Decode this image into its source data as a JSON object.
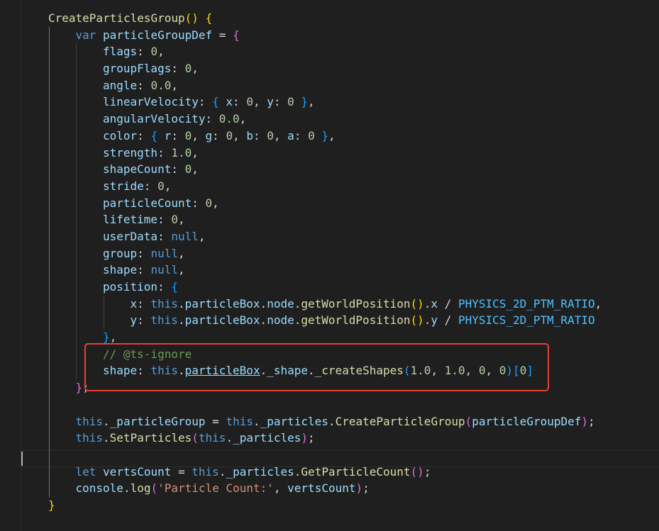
{
  "editor": {
    "theme_colors": {
      "background": "#1f1f1f",
      "function": "#dcdcaa",
      "keyword": "#569cd6",
      "variable": "#9cdcfe",
      "number": "#b5cea8",
      "string": "#ce9178",
      "constant": "#4fc1ff",
      "comment": "#6a9955",
      "bracket_level_1": "#ffd700",
      "bracket_level_2": "#da70d6",
      "bracket_level_3": "#179fff",
      "highlight_box": "#e5412f"
    },
    "lines": [
      {
        "indent": 1,
        "tokens": [
          [
            "fn",
            "CreateParticlesGroup"
          ],
          [
            "b1",
            "()"
          ],
          [
            "p",
            " "
          ],
          [
            "b1",
            "{"
          ]
        ]
      },
      {
        "indent": 2,
        "tokens": [
          [
            "kw",
            "var"
          ],
          [
            "p",
            " "
          ],
          [
            "var",
            "particleGroupDef"
          ],
          [
            "p",
            " = "
          ],
          [
            "b2",
            "{"
          ]
        ]
      },
      {
        "indent": 3,
        "tokens": [
          [
            "var",
            "flags"
          ],
          [
            "p",
            ": "
          ],
          [
            "num",
            "0"
          ],
          [
            "p",
            ","
          ]
        ]
      },
      {
        "indent": 3,
        "tokens": [
          [
            "var",
            "groupFlags"
          ],
          [
            "p",
            ": "
          ],
          [
            "num",
            "0"
          ],
          [
            "p",
            ","
          ]
        ]
      },
      {
        "indent": 3,
        "tokens": [
          [
            "var",
            "angle"
          ],
          [
            "p",
            ": "
          ],
          [
            "num",
            "0.0"
          ],
          [
            "p",
            ","
          ]
        ]
      },
      {
        "indent": 3,
        "tokens": [
          [
            "var",
            "linearVelocity"
          ],
          [
            "p",
            ": "
          ],
          [
            "b3",
            "{"
          ],
          [
            "p",
            " "
          ],
          [
            "var",
            "x"
          ],
          [
            "p",
            ": "
          ],
          [
            "num",
            "0"
          ],
          [
            "p",
            ", "
          ],
          [
            "var",
            "y"
          ],
          [
            "p",
            ": "
          ],
          [
            "num",
            "0"
          ],
          [
            "p",
            " "
          ],
          [
            "b3",
            "}"
          ],
          [
            "p",
            ","
          ]
        ]
      },
      {
        "indent": 3,
        "tokens": [
          [
            "var",
            "angularVelocity"
          ],
          [
            "p",
            ": "
          ],
          [
            "num",
            "0.0"
          ],
          [
            "p",
            ","
          ]
        ]
      },
      {
        "indent": 3,
        "tokens": [
          [
            "var",
            "color"
          ],
          [
            "p",
            ": "
          ],
          [
            "b3",
            "{"
          ],
          [
            "p",
            " "
          ],
          [
            "var",
            "r"
          ],
          [
            "p",
            ": "
          ],
          [
            "num",
            "0"
          ],
          [
            "p",
            ", "
          ],
          [
            "var",
            "g"
          ],
          [
            "p",
            ": "
          ],
          [
            "num",
            "0"
          ],
          [
            "p",
            ", "
          ],
          [
            "var",
            "b"
          ],
          [
            "p",
            ": "
          ],
          [
            "num",
            "0"
          ],
          [
            "p",
            ", "
          ],
          [
            "var",
            "a"
          ],
          [
            "p",
            ": "
          ],
          [
            "num",
            "0"
          ],
          [
            "p",
            " "
          ],
          [
            "b3",
            "}"
          ],
          [
            "p",
            ","
          ]
        ]
      },
      {
        "indent": 3,
        "tokens": [
          [
            "var",
            "strength"
          ],
          [
            "p",
            ": "
          ],
          [
            "num",
            "1.0"
          ],
          [
            "p",
            ","
          ]
        ]
      },
      {
        "indent": 3,
        "tokens": [
          [
            "var",
            "shapeCount"
          ],
          [
            "p",
            ": "
          ],
          [
            "num",
            "0"
          ],
          [
            "p",
            ","
          ]
        ]
      },
      {
        "indent": 3,
        "tokens": [
          [
            "var",
            "stride"
          ],
          [
            "p",
            ": "
          ],
          [
            "num",
            "0"
          ],
          [
            "p",
            ","
          ]
        ]
      },
      {
        "indent": 3,
        "tokens": [
          [
            "var",
            "particleCount"
          ],
          [
            "p",
            ": "
          ],
          [
            "num",
            "0"
          ],
          [
            "p",
            ","
          ]
        ]
      },
      {
        "indent": 3,
        "tokens": [
          [
            "var",
            "lifetime"
          ],
          [
            "p",
            ": "
          ],
          [
            "num",
            "0"
          ],
          [
            "p",
            ","
          ]
        ]
      },
      {
        "indent": 3,
        "tokens": [
          [
            "var",
            "userData"
          ],
          [
            "p",
            ": "
          ],
          [
            "kw",
            "null"
          ],
          [
            "p",
            ","
          ]
        ]
      },
      {
        "indent": 3,
        "tokens": [
          [
            "var",
            "group"
          ],
          [
            "p",
            ": "
          ],
          [
            "kw",
            "null"
          ],
          [
            "p",
            ","
          ]
        ]
      },
      {
        "indent": 3,
        "tokens": [
          [
            "var",
            "shape"
          ],
          [
            "p",
            ": "
          ],
          [
            "kw",
            "null"
          ],
          [
            "p",
            ","
          ]
        ]
      },
      {
        "indent": 3,
        "tokens": [
          [
            "var",
            "position"
          ],
          [
            "p",
            ": "
          ],
          [
            "b3",
            "{"
          ]
        ]
      },
      {
        "indent": 4,
        "tokens": [
          [
            "var",
            "x"
          ],
          [
            "p",
            ": "
          ],
          [
            "kw",
            "this"
          ],
          [
            "p",
            "."
          ],
          [
            "var",
            "particleBox"
          ],
          [
            "p",
            "."
          ],
          [
            "var",
            "node"
          ],
          [
            "p",
            "."
          ],
          [
            "fn",
            "getWorldPosition"
          ],
          [
            "b1",
            "()"
          ],
          [
            "p",
            "."
          ],
          [
            "var",
            "x"
          ],
          [
            "p",
            " / "
          ],
          [
            "const",
            "PHYSICS_2D_PTM_RATIO"
          ],
          [
            "p",
            ","
          ]
        ]
      },
      {
        "indent": 4,
        "tokens": [
          [
            "var",
            "y"
          ],
          [
            "p",
            ": "
          ],
          [
            "kw",
            "this"
          ],
          [
            "p",
            "."
          ],
          [
            "var",
            "particleBox"
          ],
          [
            "p",
            "."
          ],
          [
            "var",
            "node"
          ],
          [
            "p",
            "."
          ],
          [
            "fn",
            "getWorldPosition"
          ],
          [
            "b1",
            "()"
          ],
          [
            "p",
            "."
          ],
          [
            "var",
            "y"
          ],
          [
            "p",
            " / "
          ],
          [
            "const",
            "PHYSICS_2D_PTM_RATIO"
          ]
        ]
      },
      {
        "indent": 3,
        "tokens": [
          [
            "b3",
            "}"
          ],
          [
            "p",
            ","
          ]
        ]
      },
      {
        "indent": 3,
        "tokens": [
          [
            "cmt",
            "// @ts-ignore"
          ]
        ]
      },
      {
        "indent": 3,
        "tokens": [
          [
            "var",
            "shape"
          ],
          [
            "p",
            ": "
          ],
          [
            "kw",
            "this"
          ],
          [
            "p",
            "."
          ],
          [
            "varul",
            "particleBox"
          ],
          [
            "p",
            "."
          ],
          [
            "var",
            "_shape"
          ],
          [
            "p",
            "."
          ],
          [
            "fn",
            "_createShapes"
          ],
          [
            "b3",
            "("
          ],
          [
            "num",
            "1.0"
          ],
          [
            "p",
            ", "
          ],
          [
            "num",
            "1.0"
          ],
          [
            "p",
            ", "
          ],
          [
            "num",
            "0"
          ],
          [
            "p",
            ", "
          ],
          [
            "num",
            "0"
          ],
          [
            "b3",
            ")"
          ],
          [
            "b3",
            "["
          ],
          [
            "num",
            "0"
          ],
          [
            "b3",
            "]"
          ]
        ]
      },
      {
        "indent": 2,
        "tokens": [
          [
            "b2",
            "}"
          ],
          [
            "p",
            ";"
          ]
        ]
      },
      {
        "indent": 2,
        "tokens": []
      },
      {
        "indent": 2,
        "tokens": [
          [
            "kw",
            "this"
          ],
          [
            "p",
            "."
          ],
          [
            "var",
            "_particleGroup"
          ],
          [
            "p",
            " = "
          ],
          [
            "kw",
            "this"
          ],
          [
            "p",
            "."
          ],
          [
            "var",
            "_particles"
          ],
          [
            "p",
            "."
          ],
          [
            "fn",
            "CreateParticleGroup"
          ],
          [
            "b2",
            "("
          ],
          [
            "var",
            "particleGroupDef"
          ],
          [
            "b2",
            ")"
          ],
          [
            "p",
            ";"
          ]
        ]
      },
      {
        "indent": 2,
        "tokens": [
          [
            "kw",
            "this"
          ],
          [
            "p",
            "."
          ],
          [
            "fn",
            "SetParticles"
          ],
          [
            "b2",
            "("
          ],
          [
            "kw",
            "this"
          ],
          [
            "p",
            "."
          ],
          [
            "var",
            "_particles"
          ],
          [
            "b2",
            ")"
          ],
          [
            "p",
            ";"
          ]
        ]
      },
      {
        "indent": 0,
        "tokens": []
      },
      {
        "indent": 2,
        "tokens": [
          [
            "kw",
            "let"
          ],
          [
            "p",
            " "
          ],
          [
            "var",
            "vertsCount"
          ],
          [
            "p",
            " = "
          ],
          [
            "kw",
            "this"
          ],
          [
            "p",
            "."
          ],
          [
            "var",
            "_particles"
          ],
          [
            "p",
            "."
          ],
          [
            "fn",
            "GetParticleCount"
          ],
          [
            "b2",
            "()"
          ],
          [
            "p",
            ";"
          ]
        ]
      },
      {
        "indent": 2,
        "tokens": [
          [
            "var",
            "console"
          ],
          [
            "p",
            "."
          ],
          [
            "fn",
            "log"
          ],
          [
            "b2",
            "("
          ],
          [
            "str",
            "'Particle Count:'"
          ],
          [
            "p",
            ", "
          ],
          [
            "var",
            "vertsCount"
          ],
          [
            "b2",
            ")"
          ],
          [
            "p",
            ";"
          ]
        ]
      },
      {
        "indent": 1,
        "tokens": [
          [
            "b1",
            "}"
          ]
        ]
      }
    ]
  }
}
